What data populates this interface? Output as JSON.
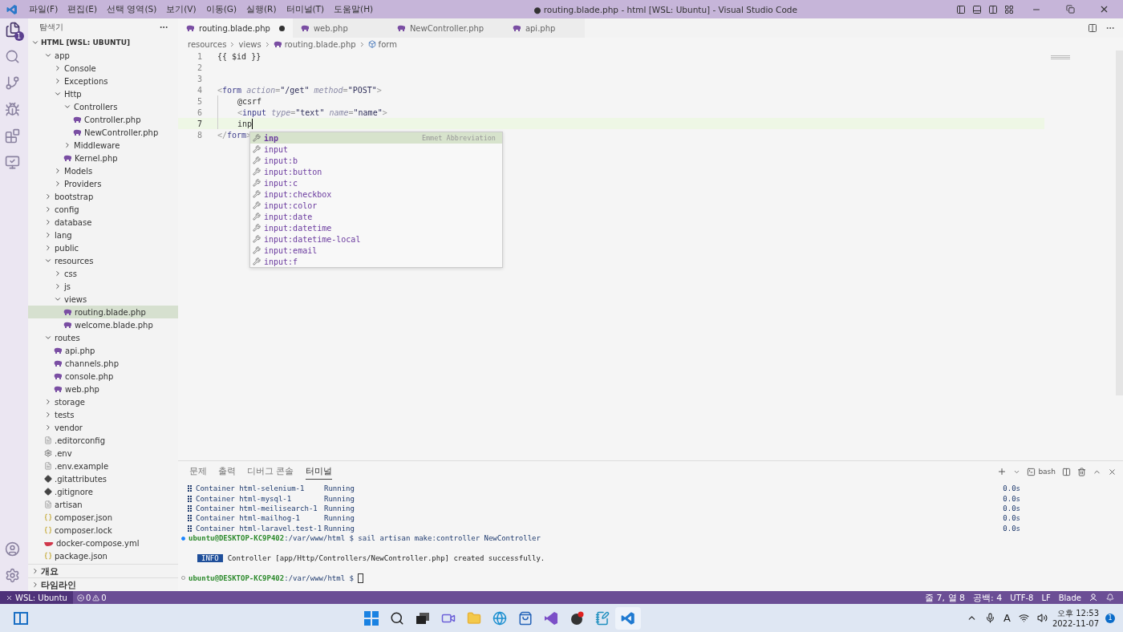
{
  "window": {
    "menu": [
      "파일(F)",
      "편집(E)",
      "선택 영역(S)",
      "보기(V)",
      "이동(G)",
      "실행(R)",
      "터미널(T)",
      "도움말(H)"
    ],
    "title": "● routing.blade.php - html [WSL: Ubuntu] - Visual Studio Code"
  },
  "activity_bar": {
    "explorer_badge": "1"
  },
  "sidebar": {
    "title": "탐색기",
    "root": "HTML [WSL: UBUNTU]",
    "tree": [
      {
        "label": "app",
        "kind": "folder",
        "expanded": true,
        "selected": false,
        "children": [
          {
            "label": "Console",
            "kind": "folder",
            "expanded": false,
            "selected": false
          },
          {
            "label": "Exceptions",
            "kind": "folder",
            "expanded": false,
            "selected": false
          },
          {
            "label": "Http",
            "kind": "folder",
            "expanded": true,
            "selected": false,
            "children": [
              {
                "label": "Controllers",
                "kind": "folder",
                "expanded": true,
                "selected": false,
                "children": [
                  {
                    "label": "Controller.php",
                    "kind": "php",
                    "selected": false
                  },
                  {
                    "label": "NewController.php",
                    "kind": "php",
                    "selected": false
                  }
                ]
              },
              {
                "label": "Middleware",
                "kind": "folder",
                "expanded": false,
                "selected": false
              },
              {
                "label": "Kernel.php",
                "kind": "php",
                "selected": false
              }
            ]
          },
          {
            "label": "Models",
            "kind": "folder",
            "expanded": false,
            "selected": false
          },
          {
            "label": "Providers",
            "kind": "folder",
            "expanded": false,
            "selected": false
          }
        ]
      },
      {
        "label": "bootstrap",
        "kind": "folder",
        "expanded": false,
        "selected": false
      },
      {
        "label": "config",
        "kind": "folder",
        "expanded": false,
        "selected": false
      },
      {
        "label": "database",
        "kind": "folder",
        "expanded": false,
        "selected": false
      },
      {
        "label": "lang",
        "kind": "folder",
        "expanded": false,
        "selected": false
      },
      {
        "label": "public",
        "kind": "folder",
        "expanded": false,
        "selected": false
      },
      {
        "label": "resources",
        "kind": "folder",
        "expanded": true,
        "selected": false,
        "children": [
          {
            "label": "css",
            "kind": "folder",
            "expanded": false,
            "selected": false
          },
          {
            "label": "js",
            "kind": "folder",
            "expanded": false,
            "selected": false
          },
          {
            "label": "views",
            "kind": "folder",
            "expanded": true,
            "selected": false,
            "children": [
              {
                "label": "routing.blade.php",
                "kind": "php",
                "selected": true
              },
              {
                "label": "welcome.blade.php",
                "kind": "php",
                "selected": false
              }
            ]
          }
        ]
      },
      {
        "label": "routes",
        "kind": "folder",
        "expanded": true,
        "selected": false,
        "children": [
          {
            "label": "api.php",
            "kind": "php",
            "selected": false
          },
          {
            "label": "channels.php",
            "kind": "php",
            "selected": false
          },
          {
            "label": "console.php",
            "kind": "php",
            "selected": false
          },
          {
            "label": "web.php",
            "kind": "php",
            "selected": false
          }
        ]
      },
      {
        "label": "storage",
        "kind": "folder",
        "expanded": false,
        "selected": false
      },
      {
        "label": "tests",
        "kind": "folder",
        "expanded": false,
        "selected": false
      },
      {
        "label": "vendor",
        "kind": "folder",
        "expanded": false,
        "selected": false
      },
      {
        "label": ".editorconfig",
        "kind": "text",
        "selected": false
      },
      {
        "label": ".env",
        "kind": "gear",
        "selected": false
      },
      {
        "label": ".env.example",
        "kind": "text",
        "selected": false
      },
      {
        "label": ".gitattributes",
        "kind": "git",
        "selected": false
      },
      {
        "label": ".gitignore",
        "kind": "git",
        "selected": false
      },
      {
        "label": "artisan",
        "kind": "text",
        "selected": false
      },
      {
        "label": "composer.json",
        "kind": "json",
        "selected": false
      },
      {
        "label": "composer.lock",
        "kind": "json",
        "selected": false
      },
      {
        "label": "docker-compose.yml",
        "kind": "docker",
        "selected": false
      },
      {
        "label": "package.json",
        "kind": "json",
        "selected": false
      }
    ],
    "sections": [
      {
        "label": "개요",
        "expanded": false
      },
      {
        "label": "타임라인",
        "expanded": false
      }
    ]
  },
  "tabs": [
    {
      "label": "routing.blade.php",
      "selected": true,
      "dirty": true
    },
    {
      "label": "web.php",
      "selected": false,
      "dirty": false
    },
    {
      "label": "NewController.php",
      "selected": false,
      "dirty": false
    },
    {
      "label": "api.php",
      "selected": false,
      "dirty": false
    }
  ],
  "breadcrumb": [
    "resources",
    "views",
    "routing.blade.php",
    "form"
  ],
  "code": [
    {
      "number": "1",
      "current": false,
      "tokens": [
        {
          "kind": "text",
          "text": "{{ $id }}"
        }
      ]
    },
    {
      "number": "2",
      "current": false
    },
    {
      "number": "3",
      "current": false
    },
    {
      "number": "4",
      "current": false,
      "tokens": [
        {
          "kind": "punct",
          "text": "<"
        },
        {
          "kind": "tag",
          "text": "form"
        },
        {
          "kind": "attr",
          "text": " action"
        },
        {
          "kind": "punct",
          "text": "="
        },
        {
          "kind": "string",
          "text": "\"/get\""
        },
        {
          "kind": "attr",
          "text": " method"
        },
        {
          "kind": "punct",
          "text": "="
        },
        {
          "kind": "string",
          "text": "\"POST\""
        },
        {
          "kind": "punct",
          "text": ">"
        }
      ]
    },
    {
      "number": "5",
      "current": false,
      "indented": true,
      "tokens": [
        {
          "kind": "text",
          "text": "@csrf"
        }
      ]
    },
    {
      "number": "6",
      "current": false,
      "indented": true,
      "tokens": [
        {
          "kind": "punct",
          "text": "<"
        },
        {
          "kind": "tag",
          "text": "input"
        },
        {
          "kind": "attr",
          "text": " type"
        },
        {
          "kind": "punct",
          "text": "="
        },
        {
          "kind": "string",
          "text": "\"text\""
        },
        {
          "kind": "attr",
          "text": " name"
        },
        {
          "kind": "punct",
          "text": "="
        },
        {
          "kind": "string",
          "text": "\"name\""
        },
        {
          "kind": "punct",
          "text": ">"
        }
      ]
    },
    {
      "number": "7",
      "current": true,
      "indented": true,
      "tokens": [
        {
          "kind": "text",
          "text": "inp"
        }
      ]
    },
    {
      "number": "8",
      "current": false,
      "tokens": [
        {
          "kind": "punct",
          "text": "</"
        },
        {
          "kind": "tag",
          "text": "form"
        },
        {
          "kind": "punct",
          "text": ">"
        }
      ]
    }
  ],
  "suggest": {
    "detail": "Emmet Abbreviation",
    "items": [
      {
        "label": "inp",
        "selected": true
      },
      {
        "label": "input",
        "selected": false
      },
      {
        "label": "input:b",
        "selected": false
      },
      {
        "label": "input:button",
        "selected": false
      },
      {
        "label": "input:c",
        "selected": false
      },
      {
        "label": "input:checkbox",
        "selected": false
      },
      {
        "label": "input:color",
        "selected": false
      },
      {
        "label": "input:date",
        "selected": false
      },
      {
        "label": "input:datetime",
        "selected": false
      },
      {
        "label": "input:datetime-local",
        "selected": false
      },
      {
        "label": "input:email",
        "selected": false
      },
      {
        "label": "input:f",
        "selected": false
      }
    ]
  },
  "panel": {
    "tabs": [
      {
        "label": "문제",
        "selected": false
      },
      {
        "label": "출력",
        "selected": false
      },
      {
        "label": "디버그 콘솔",
        "selected": false
      },
      {
        "label": "터미널",
        "selected": true
      }
    ],
    "shell": "bash",
    "lines": [
      {
        "kind": "container",
        "name": "Container html-selenium-1",
        "status": "Running",
        "time": "0.0s"
      },
      {
        "kind": "container",
        "name": "Container html-mysql-1",
        "status": "Running",
        "time": "0.0s"
      },
      {
        "kind": "container",
        "name": "Container html-meilisearch-1",
        "status": "Running",
        "time": "0.0s"
      },
      {
        "kind": "container",
        "name": "Container html-mailhog-1",
        "status": "Running",
        "time": "0.0s"
      },
      {
        "kind": "container",
        "name": "Container html-laravel.test-1",
        "status": "Running",
        "time": "0.0s"
      },
      {
        "kind": "prompt",
        "success": true,
        "user": "ubuntu@DESKTOP-KC9P402",
        "path": ":/var/www/html",
        "command": "$ sail artisan make:controller NewController",
        "cursor": false
      },
      {
        "kind": "blank"
      },
      {
        "kind": "info",
        "badge": "INFO",
        "text": "Controller [app/Http/Controllers/NewController.php] created successfully."
      },
      {
        "kind": "blank"
      },
      {
        "kind": "prompt",
        "success": false,
        "user": "ubuntu@DESKTOP-KC9P402",
        "path": ":/var/www/html",
        "command": "$",
        "cursor": true
      }
    ]
  },
  "status_bar": {
    "remote": "WSL: Ubuntu",
    "errors": "0",
    "warnings": "0",
    "right": [
      "줄 7, 열 8",
      "공백: 4",
      "UTF-8",
      "LF",
      "Blade"
    ]
  },
  "taskbar": {
    "input_mode": "A",
    "time": "오후 12:53",
    "date": "2022-11-07",
    "notifications": "1"
  }
}
